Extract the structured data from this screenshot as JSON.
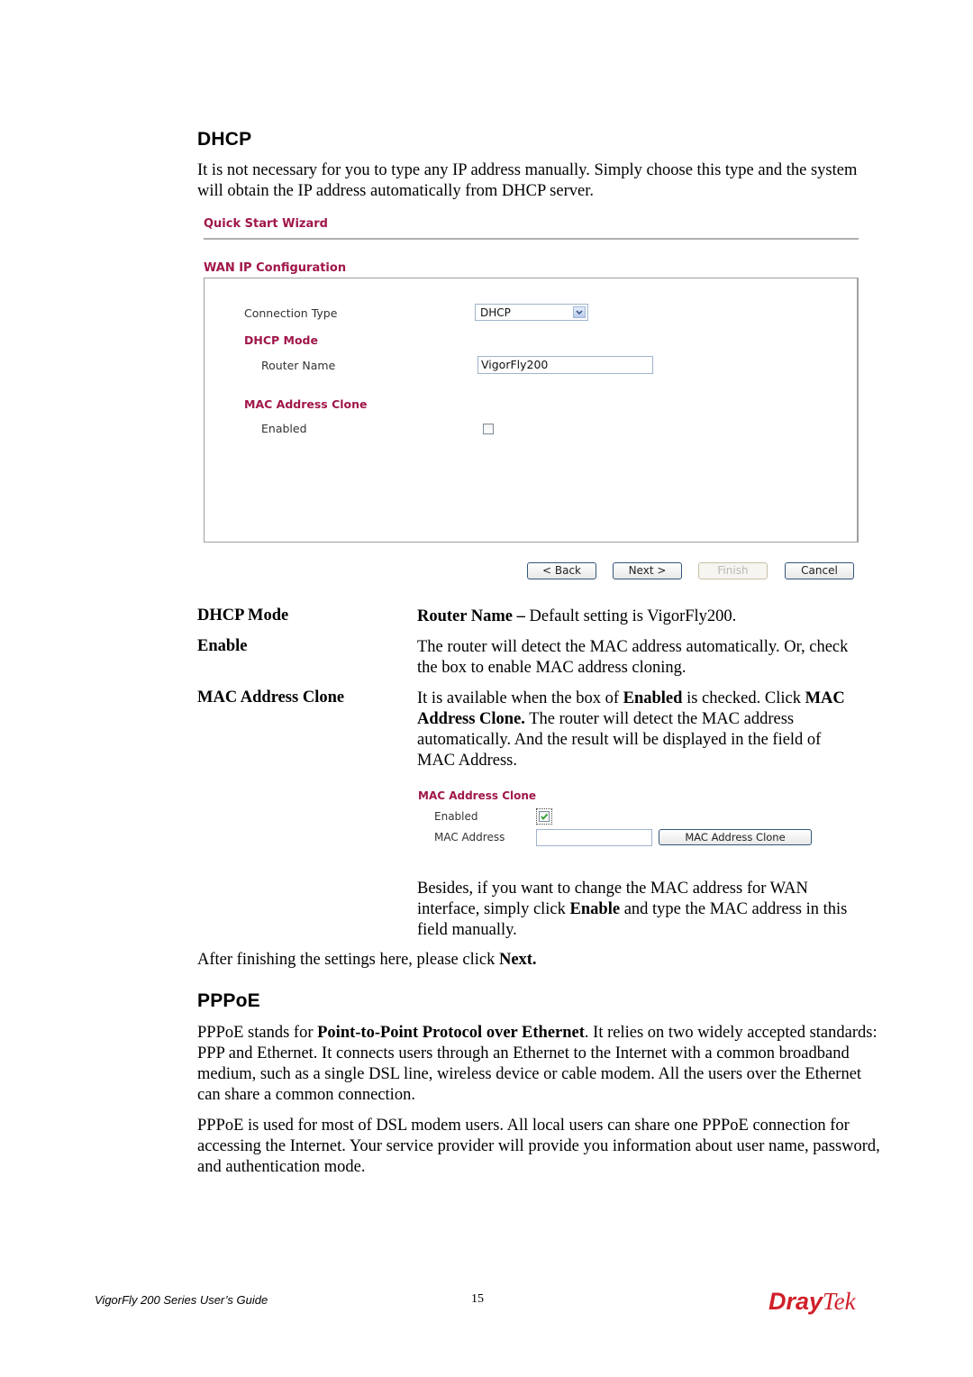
{
  "dhcp_section": {
    "heading": "DHCP",
    "intro": "It is not necessary for you to type any IP address manually. Simply choose this type and the system will obtain the IP address automatically from DHCP server."
  },
  "wizard": {
    "title": "Quick Start Wizard",
    "section_title": "WAN IP Configuration",
    "connection_type_label": "Connection Type",
    "connection_type_value": "DHCP",
    "dhcp_mode_label": "DHCP Mode",
    "router_name_label": "Router Name",
    "router_name_value": "VigorFly200",
    "mac_clone_label": "MAC Address Clone",
    "enabled_label": "Enabled",
    "enabled_checked": false,
    "buttons": {
      "back": "< Back",
      "next": "Next >",
      "finish": "Finish",
      "cancel": "Cancel"
    }
  },
  "definitions": [
    {
      "term": "DHCP Mode",
      "desc_bold": "Router Name –",
      "desc": " Default setting is VigorFly200."
    },
    {
      "term": "Enable",
      "desc": "The router will detect the MAC address automatically. Or, check the box to enable MAC address cloning."
    },
    {
      "term": "MAC Address Clone",
      "desc_p1": "It is available when the box of ",
      "desc_b1": "Enabled",
      "desc_p2": " is checked. Click ",
      "desc_b2": "MAC Address Clone.",
      "desc_p3": " The router will detect the MAC address automatically. And the result will be displayed in the field of MAC Address."
    }
  ],
  "mac_clone_shot": {
    "title": "MAC Address Clone",
    "enabled_label": "Enabled",
    "enabled_checked": true,
    "mac_address_label": "MAC Address",
    "mac_address_value": "",
    "clone_button": "MAC Address Clone"
  },
  "besides": {
    "p1": "Besides, if you want to change the MAC address for WAN interface, simply click ",
    "b1": "Enable",
    "p2": " and type the MAC address in this field manually."
  },
  "after": {
    "p1": "After finishing the settings here, please click ",
    "b1": "Next."
  },
  "pppoe_section": {
    "heading": "PPPoE",
    "p1_a": "PPPoE stands for ",
    "p1_b": "Point-to-Point Protocol over Ethernet",
    "p1_c": ". It relies on two widely accepted standards: PPP and Ethernet. It connects users through an Ethernet to the Internet with a common broadband medium, such as a single DSL line, wireless device or cable modem. All the users over the Ethernet can share a common connection.",
    "p2": "PPPoE is used for most of DSL modem users. All local users can share one PPPoE connection for accessing the Internet. Your service provider will provide you information about user name, password, and authentication mode."
  },
  "footer": {
    "guide_title": "VigorFly 200 Series User’s Guide",
    "page_number": "15",
    "logo_part1": "Dray",
    "logo_part2": "Tek",
    "logo_color": "#d0202a"
  }
}
